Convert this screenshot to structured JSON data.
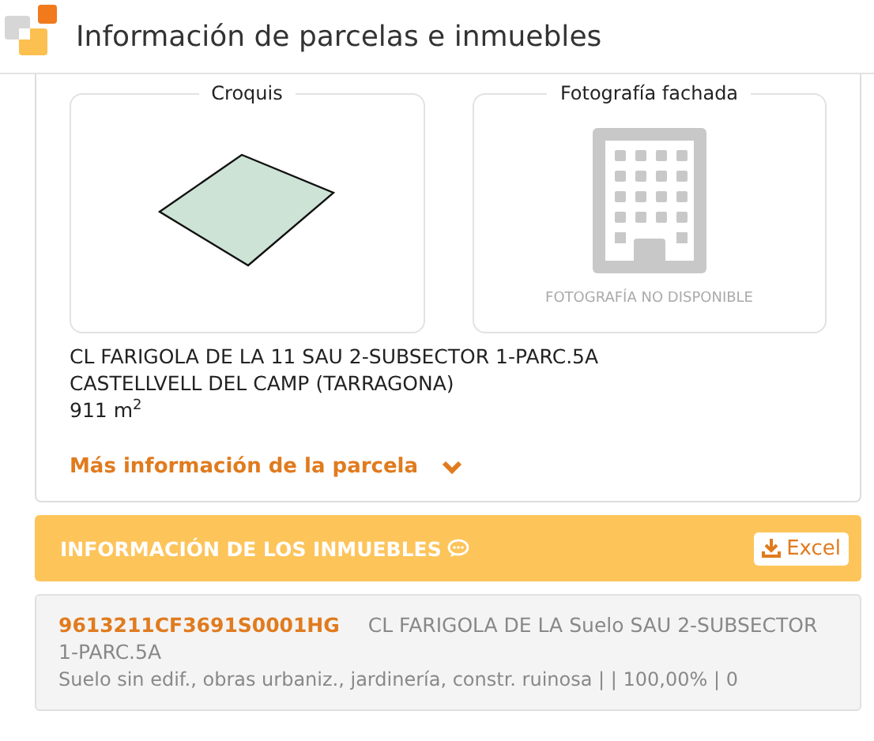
{
  "window": {
    "title": "Información de parcelas e inmuebles"
  },
  "parcel": {
    "sketch": {
      "title": "Croquis"
    },
    "photo": {
      "title": "Fotografía fachada",
      "unavailable_note": "FOTOGRAFÍA NO DISPONIBLE"
    },
    "address_lines": [
      "CL FARIGOLA DE LA 11 SAU 2-SUBSECTOR 1-PARC.5A",
      "CASTELLVELL DEL CAMP (TARRAGONA)",
      "911 m$^{2}$"
    ],
    "more_link": {
      "label": "Más información de la parcela",
      "expanded": false
    }
  },
  "properties": {
    "title": "INFORMACIÓN DE LOS INMUEBLES",
    "export_button": "Excel",
    "items": [
      {
        "reference": "9613211CF3691S0001HG",
        "address": "CL FARIGOLA DE LA Suelo SAU 2-SUBSECTOR 1-PARC.5A",
        "details": "Suelo sin edif., obras urbaniz., jardinería, constr. ruinosa | | 100,00% | 0"
      }
    ]
  }
}
